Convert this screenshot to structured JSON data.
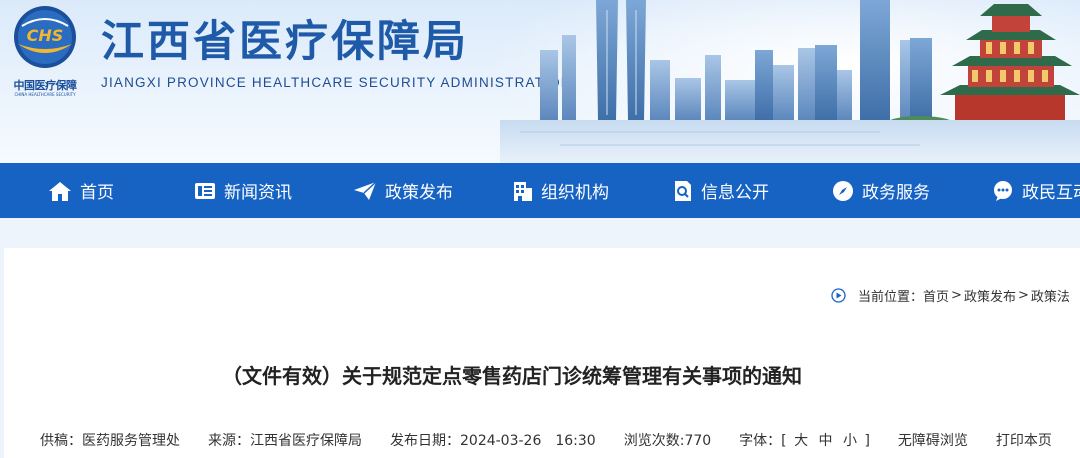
{
  "header": {
    "logo_abbr": "CHS",
    "logo_cn": "中国医疗保障",
    "logo_en": "CHINA HEALTHCARE SECURITY",
    "title": "江西省医疗保障局",
    "subtitle": "JIANGXI PROVINCE HEALTHCARE SECURITY ADMINISTRATION"
  },
  "nav": {
    "items": [
      {
        "label": "首页",
        "icon": "home-icon"
      },
      {
        "label": "新闻资讯",
        "icon": "news-icon"
      },
      {
        "label": "政策发布",
        "icon": "send-icon"
      },
      {
        "label": "组织机构",
        "icon": "building-icon"
      },
      {
        "label": "信息公开",
        "icon": "search-doc-icon"
      },
      {
        "label": "政务服务",
        "icon": "compass-icon"
      },
      {
        "label": "政民互动",
        "icon": "chat-icon"
      }
    ]
  },
  "breadcrumb": {
    "prefix": "当前位置：",
    "items": [
      "首页",
      "政策发布",
      "政策法"
    ],
    "separator": ">"
  },
  "article": {
    "title": "（文件有效）关于规范定点零售药店门诊统筹管理有关事项的通知"
  },
  "meta": {
    "supplier_label": "供稿：",
    "supplier": "医药服务管理处",
    "source_label": "来源：",
    "source": "江西省医疗保障局",
    "date_label": "发布日期：",
    "date": "2024-03-26　16:30",
    "views_label": "浏览次数:",
    "views": "770",
    "font_label": "字体：[",
    "font_large": "大",
    "font_medium": "中",
    "font_small": "小",
    "font_end": "]",
    "accessibility": "无障碍浏览",
    "print": "打印本页"
  },
  "colors": {
    "nav_bg": "#1763c4",
    "title_blue": "#1e5aa8"
  }
}
